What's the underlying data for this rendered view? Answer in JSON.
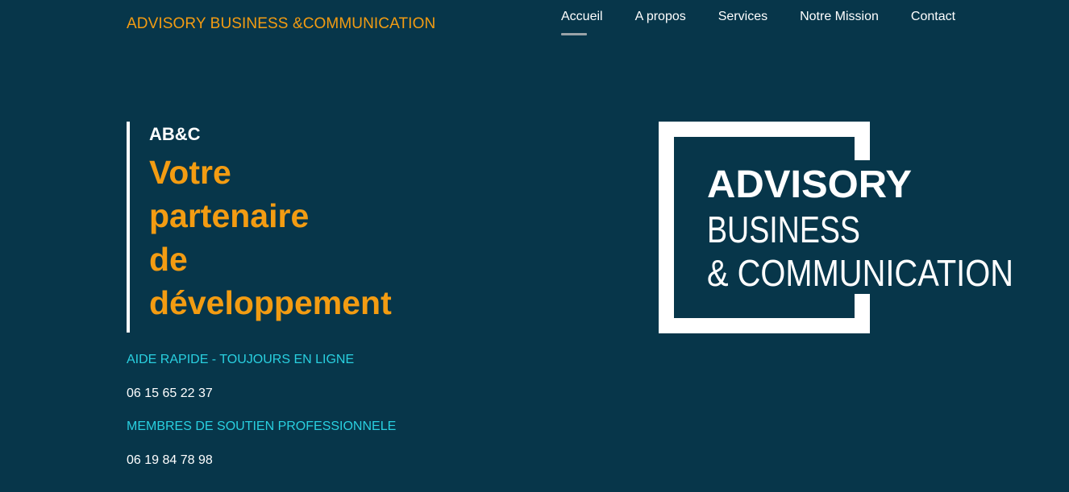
{
  "header": {
    "brand": "ADVISORY BUSINESS &COMMUNICATION",
    "nav": [
      {
        "label": "Accueil",
        "active": true
      },
      {
        "label": "A propos",
        "active": false
      },
      {
        "label": "Services",
        "active": false
      },
      {
        "label": "Notre Mission",
        "active": false
      },
      {
        "label": "Contact",
        "active": false
      }
    ]
  },
  "hero": {
    "kicker": "AB&C",
    "title_lines": [
      "Votre",
      "partenaire",
      "de",
      "développement"
    ]
  },
  "contact": {
    "help_label": "AIDE RAPIDE - TOUJOURS EN LIGNE",
    "help_phone": "06 15 65 22 37",
    "members_label": "MEMBRES DE SOUTIEN PROFESSIONNELE",
    "members_phone": "06 19 84 78 98"
  },
  "logo": {
    "line1": "ADVISORY",
    "line2": "BUSINESS",
    "line3": "& COMMUNICATION"
  },
  "colors": {
    "background": "#07364a",
    "accent": "#f39c12",
    "cyan": "#29d0e0",
    "text": "#ffffff"
  }
}
